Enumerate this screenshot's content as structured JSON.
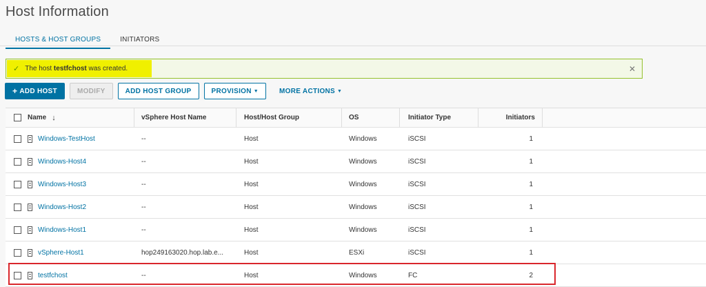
{
  "page": {
    "title": "Host Information"
  },
  "tabs": [
    {
      "label": "HOSTS & HOST GROUPS",
      "active": true
    },
    {
      "label": "INITIATORS",
      "active": false
    }
  ],
  "alert": {
    "prefix": "The host ",
    "host": "testfchost",
    "suffix": " was created.",
    "check_icon": "check-icon",
    "close_icon": "close-icon",
    "highlight_color": "#f0f000"
  },
  "toolbar": {
    "add_host": "ADD HOST",
    "modify": "MODIFY",
    "add_host_group": "ADD HOST GROUP",
    "provision": "PROVISION",
    "more_actions": "MORE ACTIONS"
  },
  "table": {
    "columns": [
      "Name",
      "vSphere Host Name",
      "Host/Host Group",
      "OS",
      "Initiator Type",
      "Initiators"
    ],
    "rows": [
      {
        "name": "Windows-TestHost",
        "vsphere": "--",
        "hg": "Host",
        "os": "Windows",
        "it": "iSCSI",
        "init": "1"
      },
      {
        "name": "Windows-Host4",
        "vsphere": "--",
        "hg": "Host",
        "os": "Windows",
        "it": "iSCSI",
        "init": "1"
      },
      {
        "name": "Windows-Host3",
        "vsphere": "--",
        "hg": "Host",
        "os": "Windows",
        "it": "iSCSI",
        "init": "1"
      },
      {
        "name": "Windows-Host2",
        "vsphere": "--",
        "hg": "Host",
        "os": "Windows",
        "it": "iSCSI",
        "init": "1"
      },
      {
        "name": "Windows-Host1",
        "vsphere": "--",
        "hg": "Host",
        "os": "Windows",
        "it": "iSCSI",
        "init": "1"
      },
      {
        "name": "vSphere-Host1",
        "vsphere": "hop249163020.hop.lab.e...",
        "hg": "Host",
        "os": "ESXi",
        "it": "iSCSI",
        "init": "1"
      },
      {
        "name": "testfchost",
        "vsphere": "--",
        "hg": "Host",
        "os": "Windows",
        "it": "FC",
        "init": "2"
      }
    ]
  },
  "colors": {
    "accent": "#0072a3",
    "success_border": "#93c12b",
    "highlight_border": "#d9262b"
  }
}
